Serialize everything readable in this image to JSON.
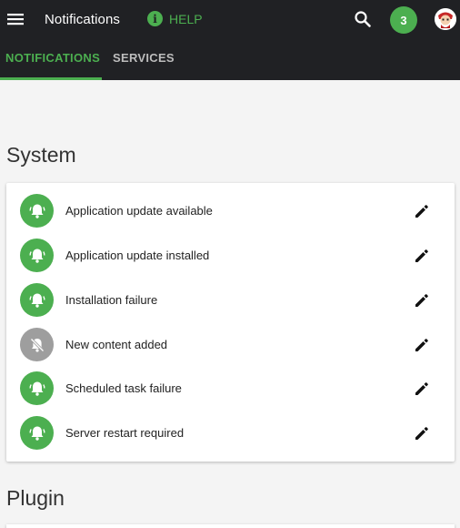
{
  "header": {
    "title": "Notifications",
    "help_label": "HELP",
    "notification_count": "3",
    "icons": {
      "menu": "hamburger-menu-icon",
      "help": "info-icon",
      "search": "search-icon",
      "avatar": "user-avatar"
    },
    "accent_color": "#4caf50",
    "bar_color": "#202124"
  },
  "tabs": [
    {
      "label": "NOTIFICATIONS",
      "active": true
    },
    {
      "label": "SERVICES",
      "active": false
    }
  ],
  "sections": [
    {
      "title": "System",
      "items": [
        {
          "label": "Application update available",
          "enabled": true,
          "icon": "bell-icon"
        },
        {
          "label": "Application update installed",
          "enabled": true,
          "icon": "bell-icon"
        },
        {
          "label": "Installation failure",
          "enabled": true,
          "icon": "bell-icon"
        },
        {
          "label": "New content added",
          "enabled": false,
          "icon": "bell-off-icon"
        },
        {
          "label": "Scheduled task failure",
          "enabled": true,
          "icon": "bell-icon"
        },
        {
          "label": "Server restart required",
          "enabled": true,
          "icon": "bell-icon"
        }
      ]
    },
    {
      "title": "Plugin",
      "items": []
    }
  ],
  "status_colors": {
    "enabled": "#4caf50",
    "disabled": "#9e9e9e"
  }
}
